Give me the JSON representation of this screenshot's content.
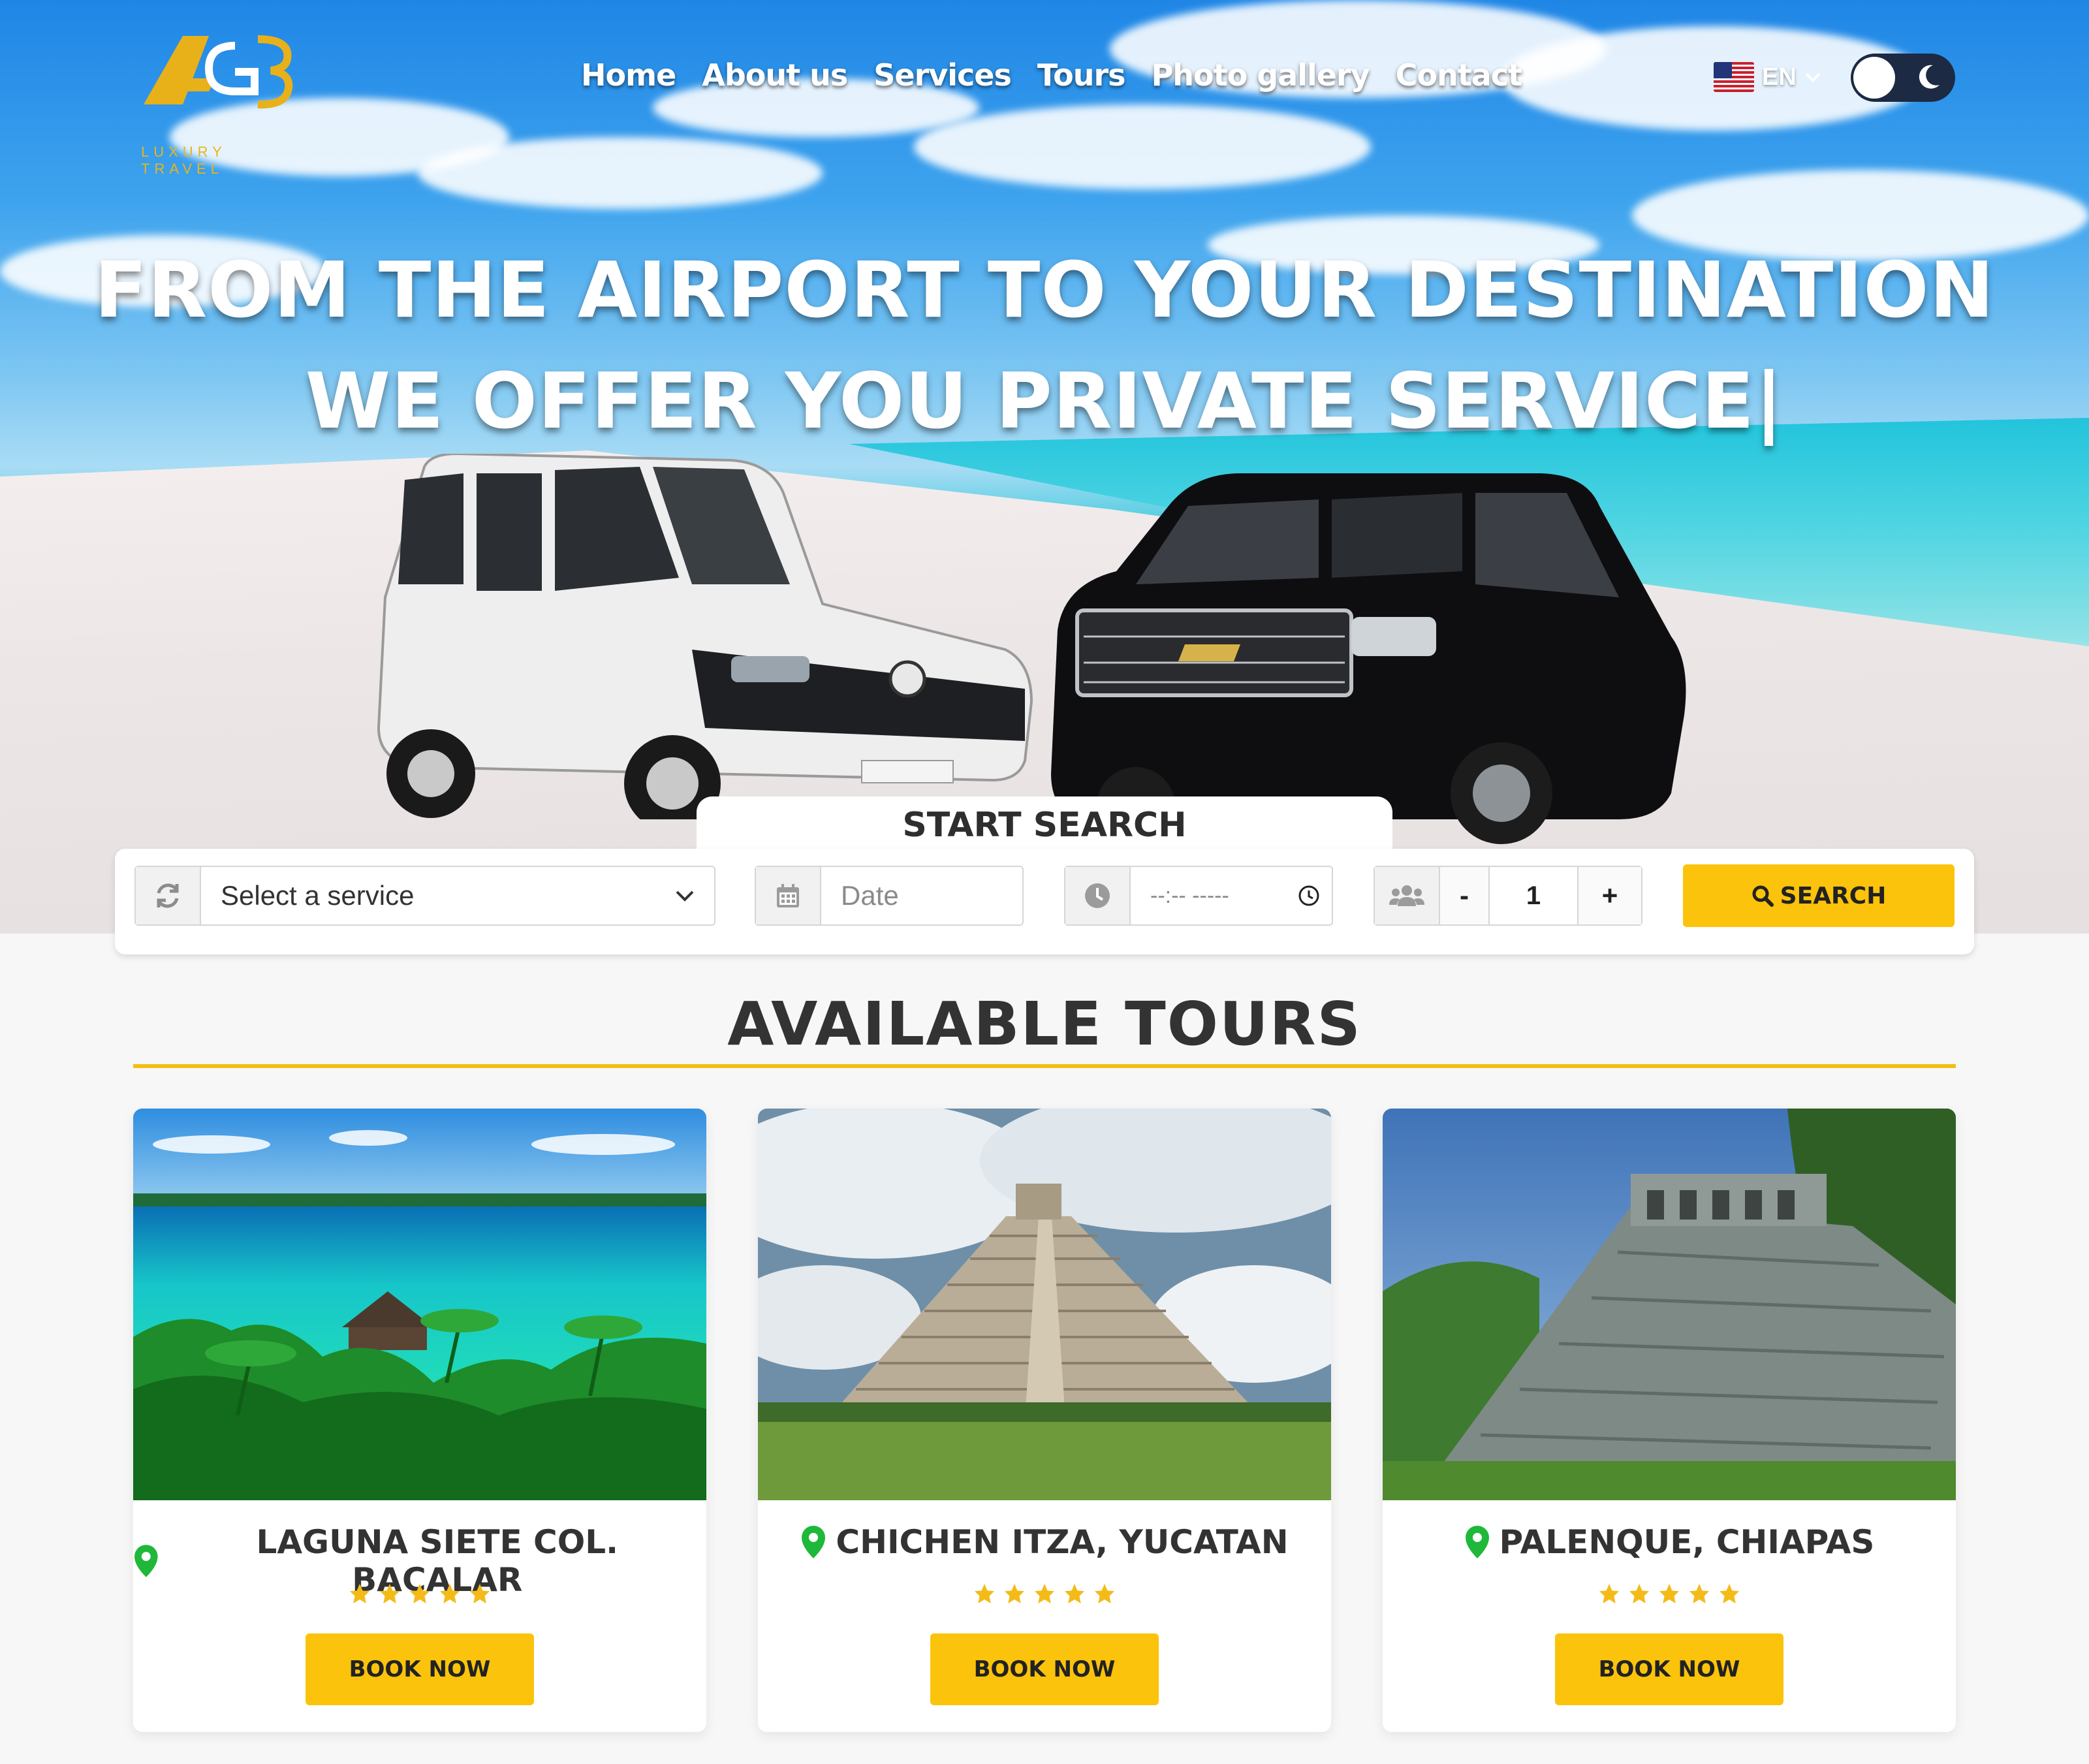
{
  "brand": {
    "logo_text": "AG3",
    "tagline": "LUXURY TRAVEL",
    "accent": "#fbc30b"
  },
  "nav": {
    "items": [
      "Home",
      "About us",
      "Services",
      "Tours",
      "Photo gallery",
      "Contact"
    ]
  },
  "language": {
    "code": "EN",
    "flag_icon": "us-flag-icon"
  },
  "theme_toggle": {
    "icon": "moon-icon"
  },
  "hero": {
    "line1": "FROM THE AIRPORT TO YOUR DESTINATION",
    "line2": "WE OFFER YOU PRIVATE SERVICE|"
  },
  "search": {
    "tab_label": "START SEARCH",
    "service_placeholder": "Select a service",
    "date_placeholder": "Date",
    "time_placeholder": "--:-- -----",
    "pax_minus": "-",
    "pax_value": "1",
    "pax_plus": "+",
    "button_label": "SEARCH"
  },
  "tours": {
    "title": "AVAILABLE TOURS",
    "items": [
      {
        "name": "LAGUNA SIETE COL. BACALAR",
        "rating": 5,
        "button": "BOOK NOW"
      },
      {
        "name": "CHICHEN ITZA, YUCATAN",
        "rating": 5,
        "button": "BOOK NOW"
      },
      {
        "name": "PALENQUE, CHIAPAS",
        "rating": 5,
        "button": "BOOK NOW"
      }
    ]
  }
}
